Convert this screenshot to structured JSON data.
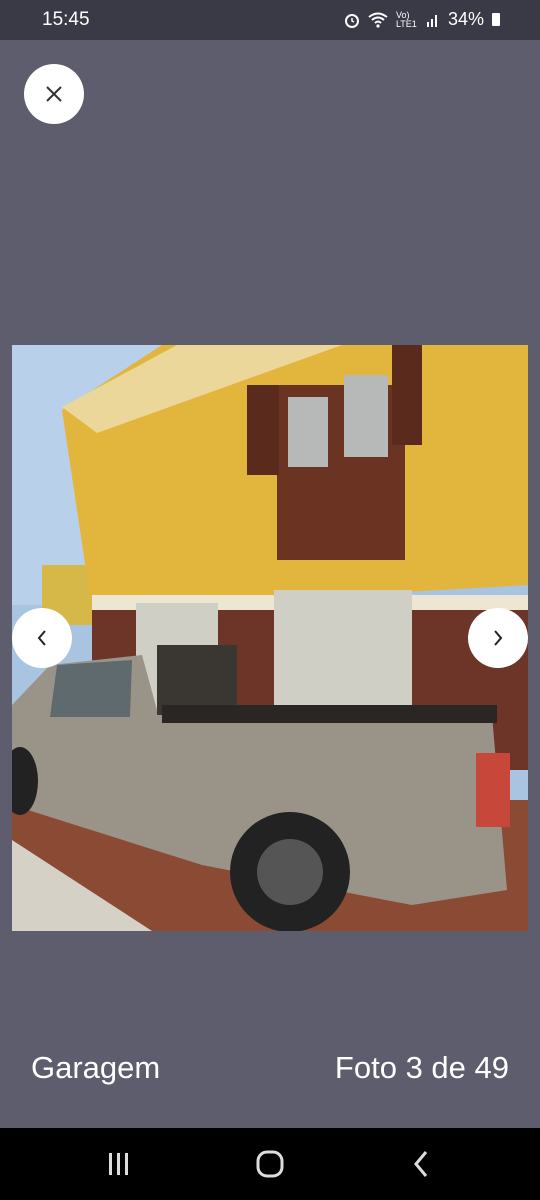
{
  "status": {
    "time": "15:45",
    "network": "Vo) LTE1",
    "battery": "34%"
  },
  "viewer": {
    "caption": "Garagem",
    "counter": "Foto 3 de 49"
  },
  "colors": {
    "background": "#5d5d6d",
    "button": "#ffffff",
    "wall": "#e2b53c",
    "truck": "#9a9488"
  },
  "icons": {
    "close": "close-icon",
    "prev": "chevron-left-icon",
    "next": "chevron-right-icon"
  }
}
